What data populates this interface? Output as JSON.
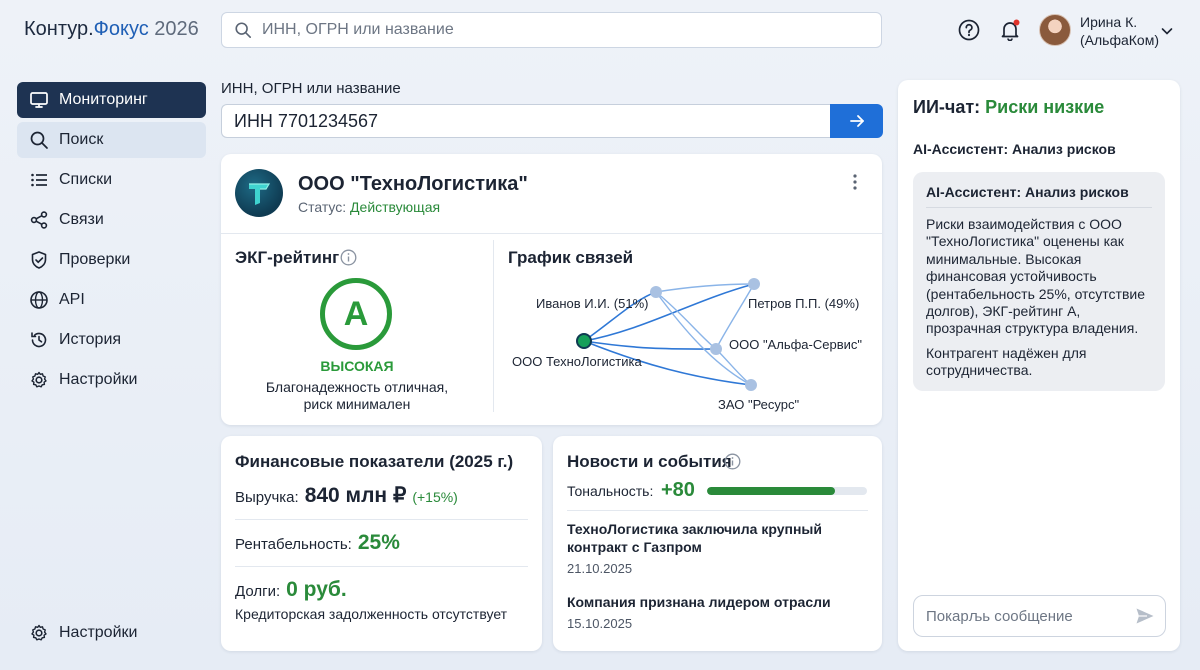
{
  "header": {
    "logo_part1": "Контур.",
    "logo_part2": "Фокус",
    "logo_year": " 2026",
    "search_placeholder": "ИНН, ОГРН или название",
    "user_name": "Ирина К.",
    "user_org": "(АльфаКом)"
  },
  "sidebar": {
    "items": [
      {
        "label": "Мониторинг",
        "icon": "monitor-icon"
      },
      {
        "label": "Поиск",
        "icon": "search-icon"
      },
      {
        "label": "Списки",
        "icon": "list-icon"
      },
      {
        "label": "Связи",
        "icon": "share-icon"
      },
      {
        "label": "Проверки",
        "icon": "shield-check-icon"
      },
      {
        "label": "API",
        "icon": "globe-icon"
      },
      {
        "label": "История",
        "icon": "history-icon"
      },
      {
        "label": "Настройки",
        "icon": "gear-icon"
      }
    ],
    "bottom_label": "Настройки"
  },
  "search": {
    "label": "ИНН, ОГРН или название",
    "value": "ИНН 7701234567"
  },
  "company": {
    "name": "ООО \"ТехноЛогистика\"",
    "status_label": "Статус: ",
    "status_value": "Действующая",
    "ekg_title": "ЭКГ-рейтинг",
    "ekg_grade": "A",
    "ekg_level": "ВЫСОКАЯ",
    "ekg_desc_line1": "Благонадежность отличная,",
    "ekg_desc_line2": "риск минимален",
    "graph_title": "График связей",
    "graph_nodes": {
      "center": "ООО ТехноЛогистика",
      "n1": "Иванов И.И. (51%)",
      "n2": "Петров П.П. (49%)",
      "n3": "ООО \"Альфа-Сервис\"",
      "n4": "ЗАО \"Ресурс\""
    }
  },
  "finance": {
    "title": "Финансовые показатели (2025 г.)",
    "revenue_label": "Выручка:",
    "revenue_value": "840 млн ₽",
    "revenue_change": "(+15%)",
    "profit_label": "Рентабельность:",
    "profit_value": "25%",
    "debt_label": "Долги:",
    "debt_value": "0 руб.",
    "debt_note": "Кредиторская задолженность отсутствует"
  },
  "news": {
    "title": "Новости и события",
    "tone_label": "Тональность:",
    "tone_value": "+80",
    "tone_fraction": 0.8,
    "items": [
      {
        "headline_line1": "ТехноЛогистика заключила крупный",
        "headline_line2": "контракт с Газпром",
        "date": "21.10.2025"
      },
      {
        "headline_line1": "Компания признана лидером отрасли",
        "headline_line2": "",
        "date": "15.10.2025"
      }
    ]
  },
  "chat": {
    "title_prefix": "ИИ-чат: ",
    "title_status": "Риски низкие",
    "subtitle": "AI-Ассистент: Анализ рисков",
    "bubble_head": "AI-Ассистент: Анализ рисков",
    "bubble_p1": "Риски взаимодействия с ООО \"ТехноЛогистика\" оценены как минимальные. Высокая финансовая устойчивость (рентабельность 25%, отсутствие долгов), ЭКГ-рейтинг А, прозрачная структура владения.",
    "bubble_p2": "Контрагент надёжен для сотрудничества.",
    "input_placeholder": "Покарљь сообщение"
  },
  "colors": {
    "accent": "#1f6fd8",
    "nav_active": "#1e3352",
    "positive": "#2a8a3a",
    "rating": "#2a9a3a"
  }
}
